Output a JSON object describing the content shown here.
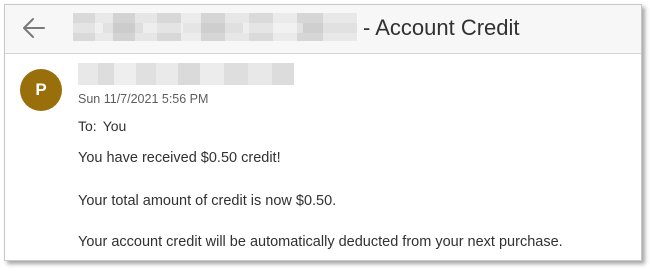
{
  "header": {
    "subject_suffix": "- Account Credit"
  },
  "message": {
    "avatar_initial": "P",
    "date": "Sun 11/7/2021 5:56 PM",
    "to_label": "To:",
    "to_value": "You",
    "body": [
      "You have received $0.50 credit!",
      "Your total amount of credit is now $0.50.",
      "Your account credit will be automatically deducted from your next purchase."
    ]
  },
  "colors": {
    "avatar": "#986f0b",
    "header_background": "#f7f7f7",
    "text": "#323130"
  },
  "icons": {
    "back": "arrow-left-icon"
  }
}
